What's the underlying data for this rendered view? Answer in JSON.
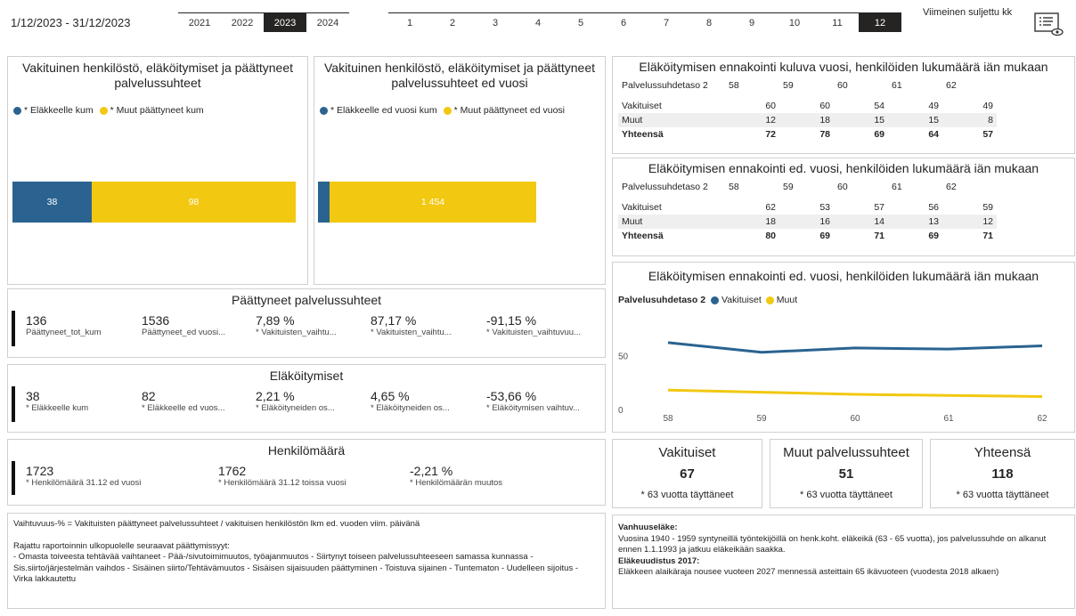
{
  "header": {
    "date_range": "1/12/2023 - 31/12/2023",
    "years": [
      "2021",
      "2022",
      "2023",
      "2024"
    ],
    "selected_year": "2023",
    "months": [
      "1",
      "2",
      "3",
      "4",
      "5",
      "6",
      "7",
      "8",
      "9",
      "10",
      "11",
      "12"
    ],
    "selected_month": "12",
    "last_closed_label": "Viimeinen suljettu kk"
  },
  "bar_current": {
    "title": "Vakituinen henkilöstö, eläköitymiset ja päättyneet palvelussuhteet",
    "legend": [
      "* Eläkkeelle kum",
      "* Muut päättyneet kum"
    ],
    "labels": [
      "38",
      "98"
    ]
  },
  "bar_prev": {
    "title": "Vakituinen henkilöstö, eläköitymiset ja päättyneet palvelussuhteet ed vuosi",
    "legend": [
      "* Eläkkeelle ed vuosi kum",
      "* Muut päättyneet ed vuosi"
    ],
    "labels": [
      "",
      "1 454"
    ]
  },
  "ended": {
    "title": "Päättyneet palvelussuhteet",
    "items": [
      {
        "value": "136",
        "label": "Päättyneet_tot_kum"
      },
      {
        "value": "1536",
        "label": "Päättyneet_ed vuosi..."
      },
      {
        "value": "7,89 %",
        "label": "* Vakituisten_vaihtu..."
      },
      {
        "value": "87,17 %",
        "label": "* Vakituisten_vaihtu..."
      },
      {
        "value": "-91,15 %",
        "label": "* Vakituisten_vaihtuvuu..."
      }
    ]
  },
  "retire": {
    "title": "Eläköitymiset",
    "items": [
      {
        "value": "38",
        "label": "* Eläkkeelle kum"
      },
      {
        "value": "82",
        "label": "* Eläkkeelle ed vuos..."
      },
      {
        "value": "2,21 %",
        "label": "* Eläköityneiden os..."
      },
      {
        "value": "4,65 %",
        "label": "* Eläköityneiden os..."
      },
      {
        "value": "-53,66 %",
        "label": "* Eläköitymisen vaihtuv..."
      }
    ]
  },
  "headcount": {
    "title": "Henkilömäärä",
    "items": [
      {
        "value": "1723",
        "label": "* Henkilömäärä 31.12 ed vuosi"
      },
      {
        "value": "1762",
        "label": "* Henkilömäärä 31.12 toissa vuosi"
      },
      {
        "value": "-2,21 %",
        "label": "* Henkilömäärän muutos"
      }
    ]
  },
  "notes_left": {
    "line1": "Vaihtuvuus-% = Vakituisten päättyneet palvelussuhteet / vakituisen henkilöstön lkm ed. vuoden viim. päivänä",
    "line2": "Rajattu raportoinnin ulkopuolelle seuraavat päättymissyyt:",
    "line3": "- Omasta toiveesta tehtävää vaihtaneet - Pää-/sivutoimimuutos, työajanmuutos - Siirtynyt toiseen palvelussuhteeseen samassa kunnassa - Sis.siirto/järjestelmän vaihdos - Sisäinen siirto/Tehtävämuutos - Sisäisen sijaisuuden päättyminen - Toistuva sijainen - Tuntematon - Uudelleen sijoitus - Virka lakkautettu"
  },
  "table_current": {
    "title": "Eläköitymisen ennakointi kuluva vuosi, henkilöiden lukumäärä iän mukaan",
    "header": "Palvelussuhdetaso 2",
    "ages": [
      "58",
      "59",
      "60",
      "61",
      "62"
    ],
    "rows": [
      {
        "name": "Vakituiset",
        "values": [
          "60",
          "60",
          "54",
          "49",
          "49"
        ]
      },
      {
        "name": "Muut",
        "values": [
          "12",
          "18",
          "15",
          "15",
          "8"
        ]
      },
      {
        "name": "Yhteensä",
        "values": [
          "72",
          "78",
          "69",
          "64",
          "57"
        ]
      }
    ]
  },
  "table_prev": {
    "title": "Eläköitymisen ennakointi ed. vuosi, henkilöiden lukumäärä iän mukaan",
    "header": "Palvelussuhdetaso 2",
    "ages": [
      "58",
      "59",
      "60",
      "61",
      "62"
    ],
    "rows": [
      {
        "name": "Vakituiset",
        "values": [
          "62",
          "53",
          "57",
          "56",
          "59"
        ]
      },
      {
        "name": "Muut",
        "values": [
          "18",
          "16",
          "14",
          "13",
          "12"
        ]
      },
      {
        "name": "Yhteensä",
        "values": [
          "80",
          "69",
          "71",
          "69",
          "71"
        ]
      }
    ]
  },
  "line_chart": {
    "title": "Eläköitymisen ennakointi ed. vuosi, henkilöiden lukumäärä iän mukaan",
    "legend_title": "Palvelusuhdetaso 2",
    "legend": [
      "Vakituiset",
      "Muut"
    ],
    "y_ticks": [
      "50",
      "0"
    ]
  },
  "chart_data": {
    "type": "line",
    "title": "Eläköitymisen ennakointi ed. vuosi, henkilöiden lukumäärä iän mukaan",
    "x": [
      "58",
      "59",
      "60",
      "61",
      "62"
    ],
    "series": [
      {
        "name": "Vakituiset",
        "values": [
          62,
          53,
          57,
          56,
          59
        ]
      },
      {
        "name": "Muut",
        "values": [
          18,
          16,
          14,
          13,
          12
        ]
      }
    ],
    "ylim": [
      0,
      85
    ],
    "grid": false,
    "legend_position": "top-left"
  },
  "cards": [
    {
      "title": "Vakituiset",
      "value": "67",
      "sub": "* 63 vuotta täyttäneet"
    },
    {
      "title": "Muut palvelussuhteet",
      "value": "51",
      "sub": "* 63 vuotta täyttäneet"
    },
    {
      "title": "Yhteensä",
      "value": "118",
      "sub": "* 63 vuotta täyttäneet"
    }
  ],
  "notes_right": {
    "h1": "Vanhuuseläke:",
    "p1": "Vuosina 1940 - 1959 syntyneillä työntekijöillä on henk.koht. eläkeikä (63 - 65 vuotta), jos palvelussuhde on alkanut ennen 1.1.1993 ja jatkuu eläkeikään saakka.",
    "h2": "Eläkeuudistus 2017:",
    "p2": "Eläkkeen alaikäraja nousee vuoteen 2027 mennessä asteittain 65 ikävuoteen (vuodesta 2018 alkaen)"
  },
  "colors": {
    "blue": "#2a6390",
    "yellow": "#f2c811"
  }
}
